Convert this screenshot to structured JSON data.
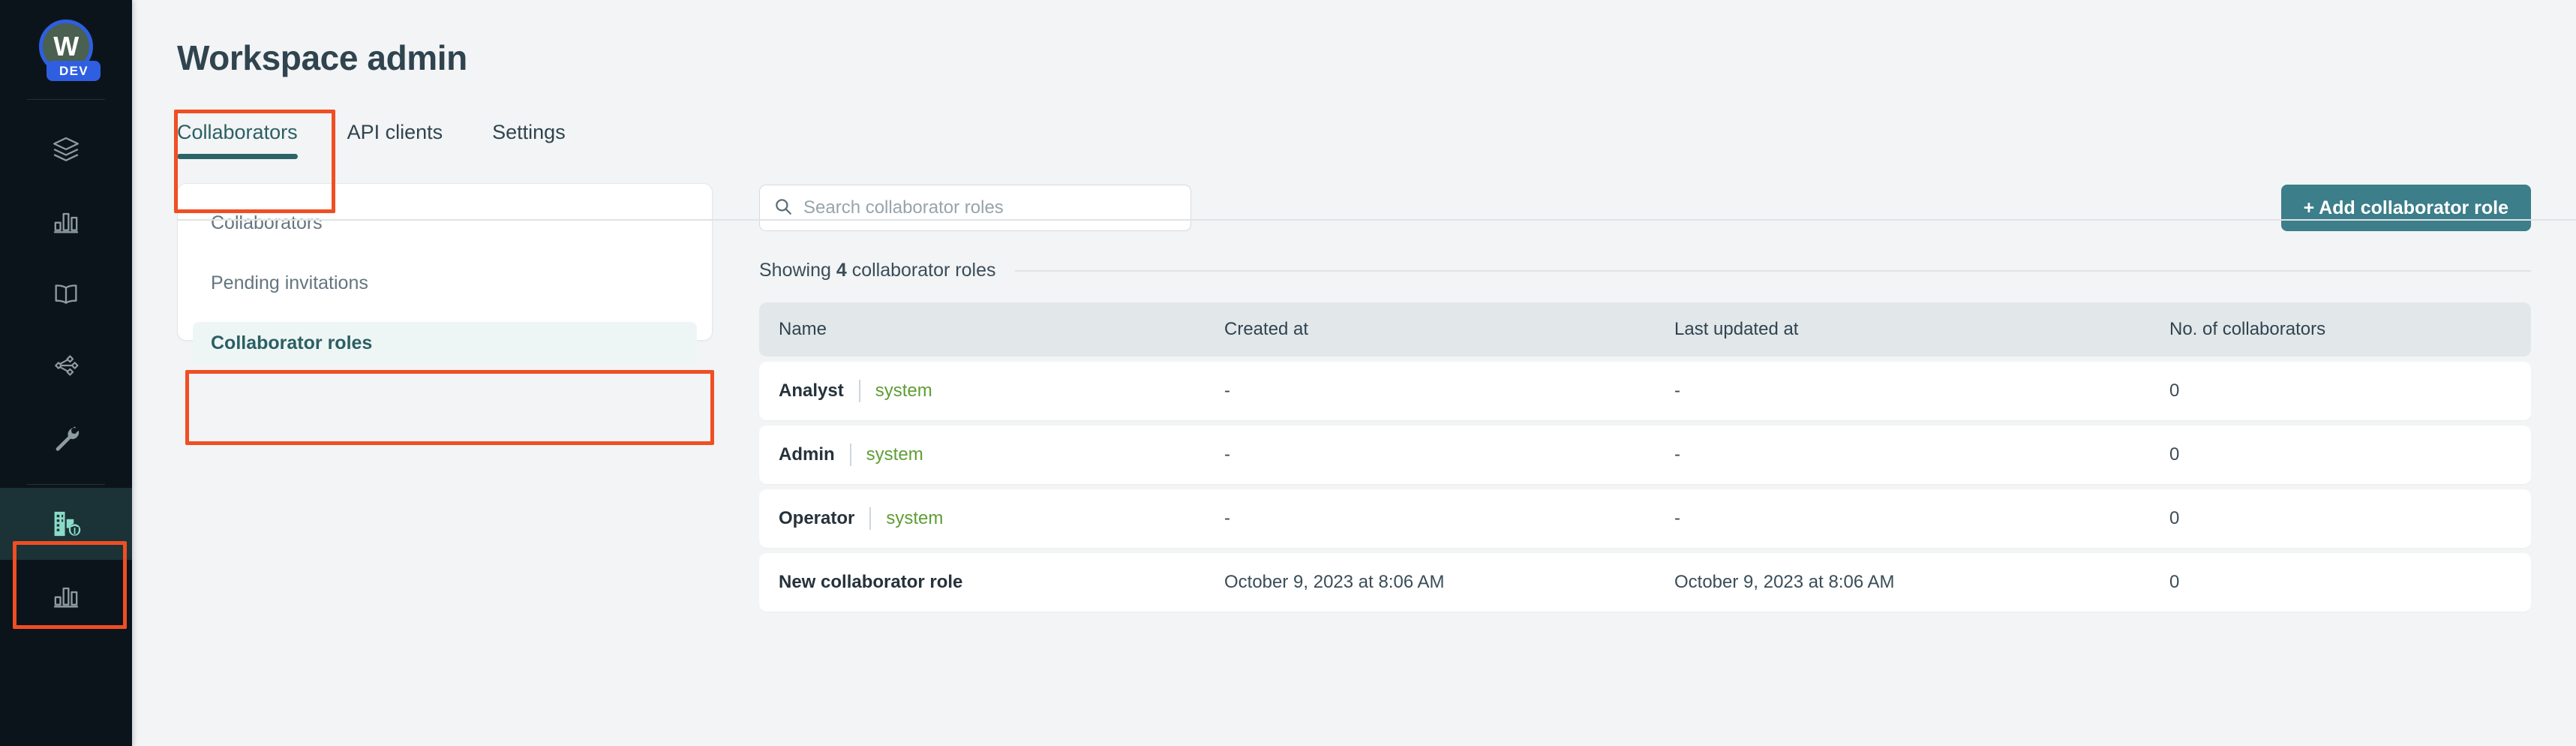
{
  "rail": {
    "logo": {
      "letter": "W",
      "badge": "DEV"
    },
    "items": [
      {
        "name": "layers-icon",
        "label": "Datasets",
        "icon": "layers",
        "active": false
      },
      {
        "name": "bar-chart-icon",
        "label": "Analytics",
        "icon": "bars",
        "active": false
      },
      {
        "name": "book-icon",
        "label": "Catalog",
        "icon": "book",
        "active": false
      },
      {
        "name": "pipeline-icon",
        "label": "Pipelines",
        "icon": "pipeline",
        "active": false
      },
      {
        "name": "wrench-icon",
        "label": "Tools",
        "icon": "wrench",
        "active": false
      },
      {
        "name": "workspace-admin-icon",
        "label": "Workspace admin",
        "icon": "building-shield",
        "active": true
      },
      {
        "name": "bar-chart-icon-2",
        "label": "Reports",
        "icon": "bars",
        "active": false
      }
    ]
  },
  "header": {
    "title": "Workspace admin"
  },
  "tabs": [
    {
      "label": "Collaborators",
      "active": true
    },
    {
      "label": "API clients",
      "active": false
    },
    {
      "label": "Settings",
      "active": false
    }
  ],
  "side_nav": [
    {
      "label": "Collaborators",
      "active": false
    },
    {
      "label": "Pending invitations",
      "active": false
    },
    {
      "label": "Collaborator roles",
      "active": true
    }
  ],
  "search": {
    "placeholder": "Search collaborator roles",
    "value": "",
    "icon": "search-icon"
  },
  "add_button": {
    "label": "+ Add collaborator role"
  },
  "showing": {
    "prefix": "Showing ",
    "count": "4",
    "suffix": " collaborator roles"
  },
  "table": {
    "columns": [
      "Name",
      "Created at",
      "Last updated at",
      "No. of collaborators"
    ],
    "rows": [
      {
        "name": "Analyst",
        "tag": "system",
        "created_at": "-",
        "updated_at": "-",
        "collaborators": "0"
      },
      {
        "name": "Admin",
        "tag": "system",
        "created_at": "-",
        "updated_at": "-",
        "collaborators": "0"
      },
      {
        "name": "Operator",
        "tag": "system",
        "created_at": "-",
        "updated_at": "-",
        "collaborators": "0"
      },
      {
        "name": "New collaborator role",
        "tag": "",
        "created_at": "October 9, 2023 at 8:06 AM",
        "updated_at": "October 9, 2023 at 8:06 AM",
        "collaborators": "0"
      }
    ]
  },
  "colors": {
    "accent_teal": "#3c7e8a",
    "rail_bg": "#0c141b",
    "annotation": "#f04e23",
    "system_tag": "#5e9e34",
    "active_rail": "#1b3236"
  }
}
